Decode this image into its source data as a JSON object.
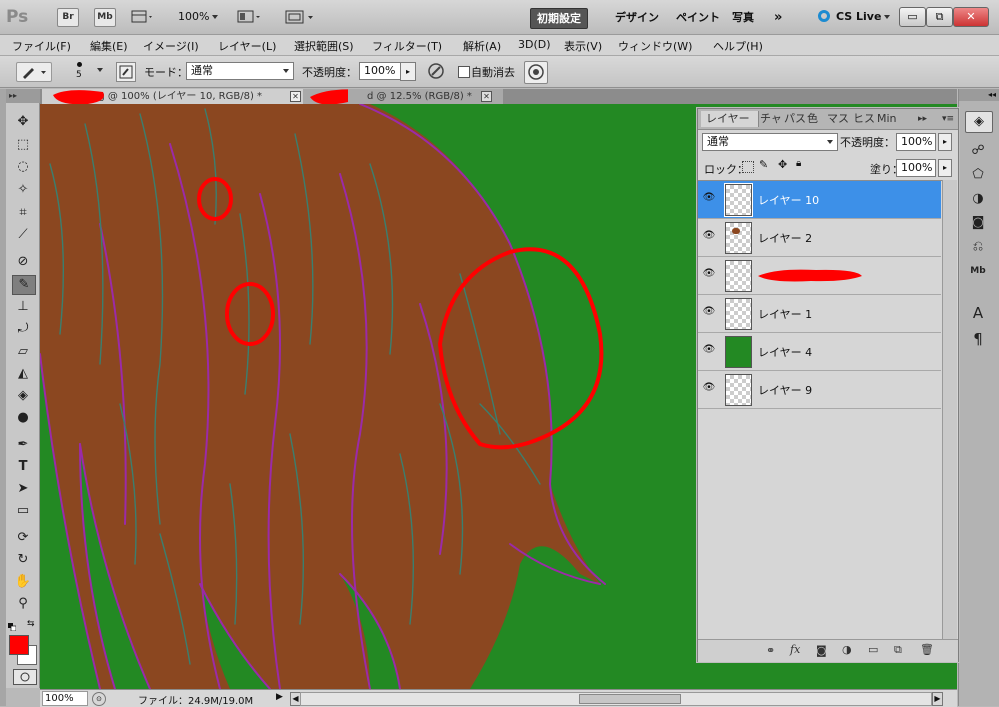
{
  "app": {
    "logo": "Ps",
    "bridge": "Br",
    "minibridge": "Mb",
    "zoom": "100%",
    "workspaces": [
      "初期設定",
      "デザイン",
      "ペイント",
      "写真"
    ],
    "more": "»",
    "cslive": "CS Live",
    "win_min": "▭",
    "win_restore": "⧉",
    "win_close": "✕"
  },
  "menu": [
    "ファイル(F)",
    "編集(E)",
    "イメージ(I)",
    "レイヤー(L)",
    "選択範囲(S)",
    "フィルター(T)",
    "解析(A)",
    "3D(D)",
    "表示(V)",
    "ウィンドウ(W)",
    "ヘルプ(H)"
  ],
  "options": {
    "brush_size": "5",
    "mode_label": "モード：",
    "mode_value": "通常",
    "opacity_label": "不透明度：",
    "opacity_value": "100%",
    "auto_erase": "自動消去"
  },
  "tabs": [
    {
      "label": "pg @ 100% (レイヤー 10, RGB/8) *"
    },
    {
      "label": "d @ 12.5% (RGB/8) *"
    }
  ],
  "status": {
    "zoom": "100%",
    "file_info": "ファイル：24.9M/19.0M"
  },
  "layers_panel": {
    "tabs": [
      "レイヤー",
      "チャ",
      "パス",
      "色",
      "マス",
      "ヒス",
      "Min"
    ],
    "blend_mode": "通常",
    "opacity_label": "不透明度：",
    "opacity_value": "100%",
    "lock_label": "ロック：",
    "fill_label": "塗り：",
    "fill_value": "100%",
    "layers": [
      {
        "name": "レイヤー 10",
        "selected": true
      },
      {
        "name": "レイヤー 2",
        "selected": false
      },
      {
        "name": "",
        "selected": false,
        "redacted": true
      },
      {
        "name": "レイヤー 1",
        "selected": false
      },
      {
        "name": "レイヤー 4",
        "selected": false,
        "thumb": "#238923"
      },
      {
        "name": "レイヤー 9",
        "selected": false
      }
    ],
    "bottom_icons": [
      "link-icon",
      "fx-icon",
      "mask-icon",
      "adjustment-icon",
      "group-icon",
      "new-layer-icon",
      "trash-icon"
    ]
  },
  "colors": {
    "canvas_bg": "#238923",
    "hair": "#8b4720",
    "hair_outline": "#9b2aa8",
    "annotation": "#ff0000",
    "foreground": "#ff0000",
    "background": "#ffffff",
    "selected_layer": "#3d90e8"
  }
}
